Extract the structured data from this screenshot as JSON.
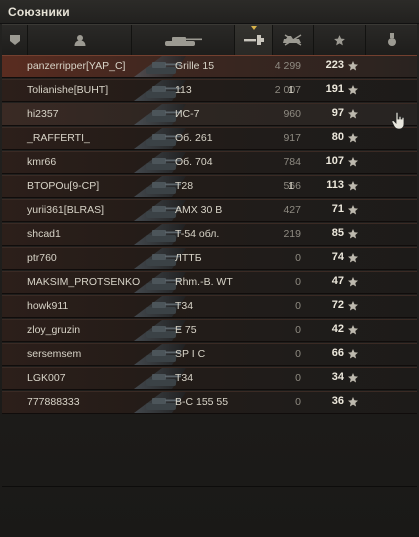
{
  "panel": {
    "title": "Союзники"
  },
  "header": {
    "columns": [
      {
        "icon": "squad-icon"
      },
      {
        "icon": "player-icon"
      },
      {
        "icon": "tank-icon"
      },
      {
        "icon": "damage-icon",
        "sorted": true
      },
      {
        "icon": "kills-icon"
      },
      {
        "icon": "star-icon"
      },
      {
        "icon": "medal-icon"
      }
    ]
  },
  "colors": {
    "row_base": "#241c18",
    "row_highlight": "#5a2c20",
    "sort_caret": "#d7b24a",
    "text": "#d8d4c8"
  },
  "rows": [
    {
      "player": "panzerripper[YAP_C]",
      "vehicle": "Grille 15",
      "damage": "4 299",
      "kills": "",
      "xp": "223",
      "state": "highlight"
    },
    {
      "player": "Tolianishe[BUHT]",
      "vehicle": "113",
      "damage": "2 007",
      "kills": "1",
      "xp": "191",
      "state": ""
    },
    {
      "player": "hi2357",
      "vehicle": "ИС-7",
      "damage": "960",
      "kills": "",
      "xp": "97",
      "state": "hover"
    },
    {
      "player": "_RAFFERTI_",
      "vehicle": "Об. 261",
      "damage": "917",
      "kills": "",
      "xp": "80",
      "state": ""
    },
    {
      "player": "kmr66",
      "vehicle": "Об. 704",
      "damage": "784",
      "kills": "",
      "xp": "107",
      "state": ""
    },
    {
      "player": "BTOPOu[9-CP]",
      "vehicle": "T28",
      "damage": "566",
      "kills": "1",
      "xp": "113",
      "state": ""
    },
    {
      "player": "yurii361[BLRAS]",
      "vehicle": "AMX 30 B",
      "damage": "427",
      "kills": "",
      "xp": "71",
      "state": ""
    },
    {
      "player": "shcad1",
      "vehicle": "T-54 обл.",
      "damage": "219",
      "kills": "",
      "xp": "85",
      "state": ""
    },
    {
      "player": "ptr760",
      "vehicle": "ЛТТБ",
      "damage": "0",
      "kills": "",
      "xp": "74",
      "state": ""
    },
    {
      "player": "MAKSIM_PROTSENKO",
      "vehicle": "Rhm.-B. WT",
      "damage": "0",
      "kills": "",
      "xp": "47",
      "state": ""
    },
    {
      "player": "howk911",
      "vehicle": "T34",
      "damage": "0",
      "kills": "",
      "xp": "72",
      "state": ""
    },
    {
      "player": "zloy_gruzin",
      "vehicle": "E 75",
      "damage": "0",
      "kills": "",
      "xp": "42",
      "state": ""
    },
    {
      "player": "sersemsem",
      "vehicle": "SP I C",
      "damage": "0",
      "kills": "",
      "xp": "66",
      "state": ""
    },
    {
      "player": "LGK007",
      "vehicle": "T34",
      "damage": "0",
      "kills": "",
      "xp": "34",
      "state": ""
    },
    {
      "player": "777888333",
      "vehicle": "B-C 155 55",
      "damage": "0",
      "kills": "",
      "xp": "36",
      "state": ""
    }
  ]
}
